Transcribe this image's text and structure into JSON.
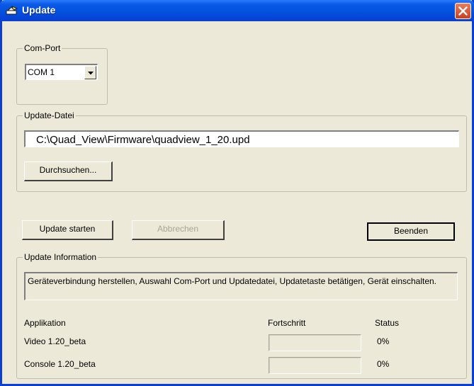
{
  "window": {
    "title": "Update"
  },
  "com_port": {
    "legend": "Com-Port",
    "selected": "COM 1"
  },
  "update_file": {
    "legend": "Update-Datei",
    "path": "C:\\Quad_View\\Firmware\\quadview_1_20.upd",
    "browse_label": "Durchsuchen..."
  },
  "actions": {
    "start_label": "Update starten",
    "cancel_label": "Abbrechen",
    "exit_label": "Beenden"
  },
  "info": {
    "legend": "Update Information",
    "message": "Geräteverbindung herstellen, Auswahl Com-Port und Updatedatei, Updatetaste betätigen, Gerät einschalten.",
    "headers": {
      "application": "Applikation",
      "progress": "Fortschritt",
      "status": "Status"
    },
    "rows": [
      {
        "application": "Video  1.20_beta",
        "progress": 0,
        "status": "0%"
      },
      {
        "application": "Console  1.20_beta",
        "progress": 0,
        "status": "0%"
      }
    ]
  }
}
